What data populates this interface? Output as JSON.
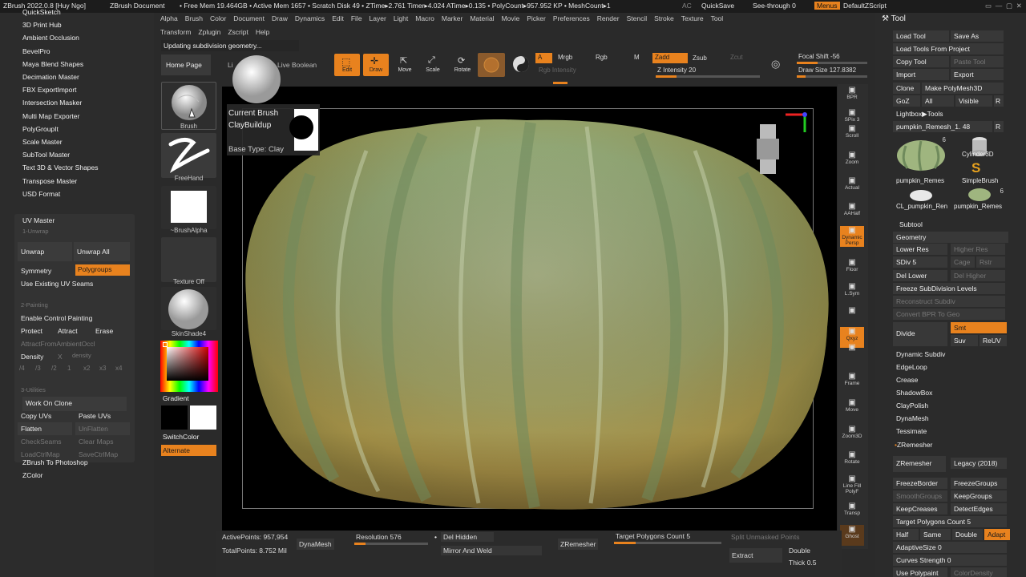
{
  "titlebar": {
    "app": "ZBrush 2022.0.8 [Huy Ngo]",
    "doc": "ZBrush Document",
    "stats": "• Free Mem 19.464GB • Active Mem 1657 • Scratch Disk 49 • ZTime▸2.761 Timer▸4.024 ATime▸0.135 • PolyCount▸957.952 KP • MeshCount▸1",
    "ac": "AC",
    "quicksave": "QuickSave",
    "seethrough": "See-through",
    "seethrough_value": "0",
    "menus": "Menus",
    "script": "DefaultZScript"
  },
  "menu_row1": [
    "Alpha",
    "Brush",
    "Color",
    "Document",
    "Draw",
    "Dynamics",
    "Edit",
    "File",
    "Layer",
    "Light",
    "Macro",
    "Marker",
    "Material",
    "Movie",
    "Picker",
    "Preferences",
    "Render",
    "Stencil",
    "Stroke",
    "Texture",
    "Tool"
  ],
  "menu_row2": [
    "Transform",
    "Zplugin",
    "Zscript",
    "Help"
  ],
  "status_message": "Updating subdivision geometry...",
  "left_plugins": [
    "QuickSketch",
    "3D Print Hub",
    "Ambient Occlusion",
    "BevelPro",
    "Maya Blend Shapes",
    "Decimation Master",
    "FBX ExportImport",
    "Intersection Masker",
    "Multi Map Exporter",
    "PolyGroupIt",
    "Scale Master",
    "SubTool Master",
    "Text 3D & Vector Shapes",
    "Transpose Master",
    "USD Format"
  ],
  "uv_master": {
    "title": "UV Master",
    "section1": "1-Unwrap",
    "unwrap": "Unwrap",
    "unwrap_all": "Unwrap All",
    "symmetry": "Symmetry",
    "polygroups": "Polygroups",
    "use_seams": "Use Existing UV Seams",
    "section2": "2-Painting",
    "enable_cp": "Enable Control Painting",
    "protect": "Protect",
    "attract": "Attract",
    "erase": "Erase",
    "attract_ao": "AttractFromAmbientOccl",
    "density": "Density",
    "density_x": "X",
    "density_label": "density",
    "density_vals": [
      "/4",
      "/3",
      "/2",
      "1",
      "x2",
      "x3",
      "x4"
    ],
    "section3": "3-Utilities",
    "work_on_clone": "Work On Clone",
    "copy_uvs": "Copy UVs",
    "paste_uvs": "Paste UVs",
    "flatten": "Flatten",
    "unflatten": "UnFlatten",
    "check_seams": "CheckSeams",
    "clear_maps": "Clear Maps",
    "load_ctrl": "LoadCtrlMap",
    "save_ctrl": "SaveCtrlMap"
  },
  "left_bottom": [
    "ZBrush To Photoshop",
    "ZColor"
  ],
  "brush_column": {
    "home": "Home Page",
    "lightbox": "Li",
    "live_boolean": "Live Boolean",
    "brush": "Brush",
    "freehand": "FreeHand",
    "alpha": "~BrushAlpha",
    "texture": "Texture Off",
    "material": "SkinShade4",
    "gradient": "Gradient",
    "switch_color": "SwitchColor",
    "alternate": "Alternate"
  },
  "brush_popup": {
    "current": "Current Brush",
    "name": "ClayBuildup",
    "base": "Base Type: Clay"
  },
  "toolbar": {
    "edit": "Edit",
    "draw": "Draw",
    "move": "Move",
    "scale": "Scale",
    "rotate": "Rotate",
    "a": "A",
    "mrgb": "Mrgb",
    "rgb": "Rgb",
    "m": "M",
    "rgb_intensity": "Rgb Intensity",
    "zadd": "Zadd",
    "zsub": "Zsub",
    "zcut": "Zcut",
    "z_intensity": "Z Intensity",
    "z_intensity_value": "20",
    "focal_shift": "Focal Shift",
    "focal_value": "-56",
    "draw_size": "Draw Size",
    "draw_size_value": "127.8382"
  },
  "right_shelf": [
    "BPR",
    "SPix 3",
    "Scroll",
    "Zoom",
    "Actual",
    "AAHalf",
    "Dynamic Persp",
    "Floor",
    "L.Sym",
    "",
    "Qxyz",
    "",
    "Frame",
    "Move",
    "Zoom3D",
    "Rotate",
    "Line Fill PolyF",
    "Transp",
    "Ghost"
  ],
  "tool_panel": {
    "title": "Tool",
    "load_tool": "Load Tool",
    "save_as": "Save As",
    "load_from_project": "Load Tools From Project",
    "copy_tool": "Copy Tool",
    "paste_tool": "Paste Tool",
    "import": "Import",
    "export": "Export",
    "clone": "Clone",
    "make_polymesh": "Make PolyMesh3D",
    "goz": "GoZ",
    "all": "All",
    "visible": "Visible",
    "r": "R",
    "lightbox_tools": "Lightbox▶Tools",
    "current_tool": "pumpkin_Remesh_1.",
    "current_tool_count": "48",
    "thumbs": [
      {
        "label": "pumpkin_Remes",
        "badge": "6"
      },
      {
        "label": "Cylinder3D",
        "badge": ""
      },
      {
        "label": "SimpleBrush",
        "badge": ""
      },
      {
        "label": "CL_pumpkin_Ren",
        "badge": ""
      },
      {
        "label": "pumpkin_Remes",
        "badge": "6"
      }
    ],
    "subtool": "Subtool",
    "geometry": "Geometry",
    "lower_res": "Lower Res",
    "higher_res": "Higher Res",
    "sdiv": "SDiv",
    "sdiv_value": "5",
    "cage": "Cage",
    "rstr": "Rstr",
    "del_lower": "Del Lower",
    "del_higher": "Del Higher",
    "freeze_sub": "Freeze SubDivision Levels",
    "reconstruct": "Reconstruct Subdiv",
    "convert_bpr": "Convert BPR To Geo",
    "divide": "Divide",
    "smt": "Smt",
    "suv": "Suv",
    "reuv": "ReUV",
    "dynamic_subdiv": "Dynamic Subdiv",
    "edgeloop": "EdgeLoop",
    "crease": "Crease",
    "shadowbox": "ShadowBox",
    "claypolish": "ClayPolish",
    "dynamesh": "DynaMesh",
    "tessimate": "Tessimate",
    "zremesher_section": "ZRemesher",
    "zremesher_btn": "ZRemesher",
    "legacy": "Legacy (2018)",
    "freeze_border": "FreezeBorder",
    "freeze_groups": "FreezeGroups",
    "smooth_groups": "SmoothGroups",
    "keep_groups": "KeepGroups",
    "keep_creases": "KeepCreases",
    "detect_edges": "DetectEdges",
    "target_poly": "Target Polygons Count",
    "target_poly_value": "5",
    "half": "Half",
    "same": "Same",
    "double": "Double",
    "adapt": "Adapt",
    "adaptive_size": "AdaptiveSize",
    "adaptive_value": "0",
    "curves_strength": "Curves Strength",
    "curves_value": "0",
    "use_polypaint": "Use Polypaint",
    "color_density": "ColorDensity"
  },
  "bottom": {
    "active_points": "ActivePoints: 957,954",
    "total_points": "TotalPoints: 8.752 Mil",
    "dynamesh": "DynaMesh",
    "resolution": "Resolution",
    "resolution_value": "576",
    "del_hidden": "Del Hidden",
    "mirror_weld": "Mirror And Weld",
    "zremesher": "ZRemesher",
    "target_poly": "Target Polygons Count",
    "target_value": "5",
    "split_unmasked": "Split Unmasked Points",
    "extract": "Extract",
    "double": "Double",
    "thick": "Thick",
    "thick_value": "0.5"
  },
  "colors": {
    "accent": "#e8821e",
    "panel": "#2c2c2c",
    "viewport": "#000000"
  }
}
